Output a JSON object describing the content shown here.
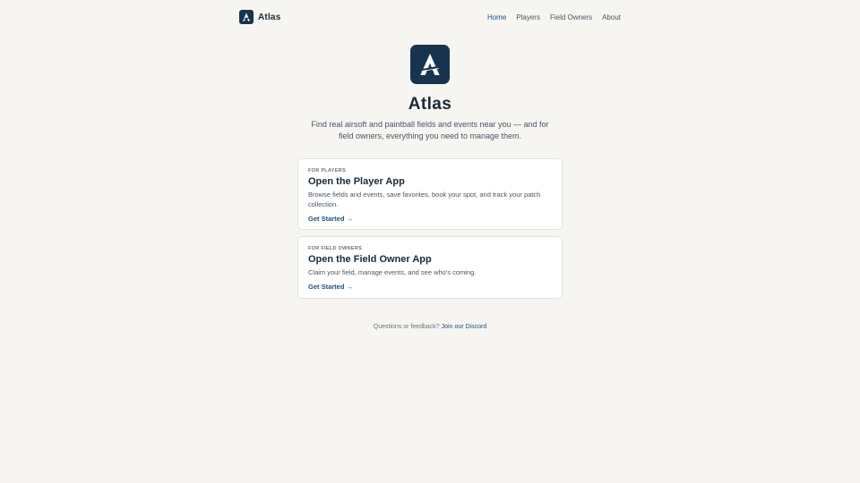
{
  "header": {
    "brand_name": "Atlas",
    "nav": [
      "Home",
      "Players",
      "Field Owners",
      "About"
    ]
  },
  "hero": {
    "title": "Atlas",
    "subtitle": "Find real airsoft and paintball fields and events near you — and for field owners, everything you need to manage them."
  },
  "cards": [
    {
      "eyebrow": "FOR PLAYERS",
      "title": "Open the Player App",
      "description": "Browse fields and events, save favorites, book your spot, and track your patch collection.",
      "cta": "Get Started →"
    },
    {
      "eyebrow": "FOR FIELD OWNERS",
      "title": "Open the Field Owner App",
      "description": "Claim your field, manage events, and see who's coming.",
      "cta": "Get Started →"
    }
  ],
  "footer": {
    "text": "Questions or feedback?",
    "link": "Join our Discord"
  },
  "colors": {
    "background": "#f6f5f1",
    "brand_navy": "#16344e",
    "link_blue": "#1e4e7e"
  }
}
